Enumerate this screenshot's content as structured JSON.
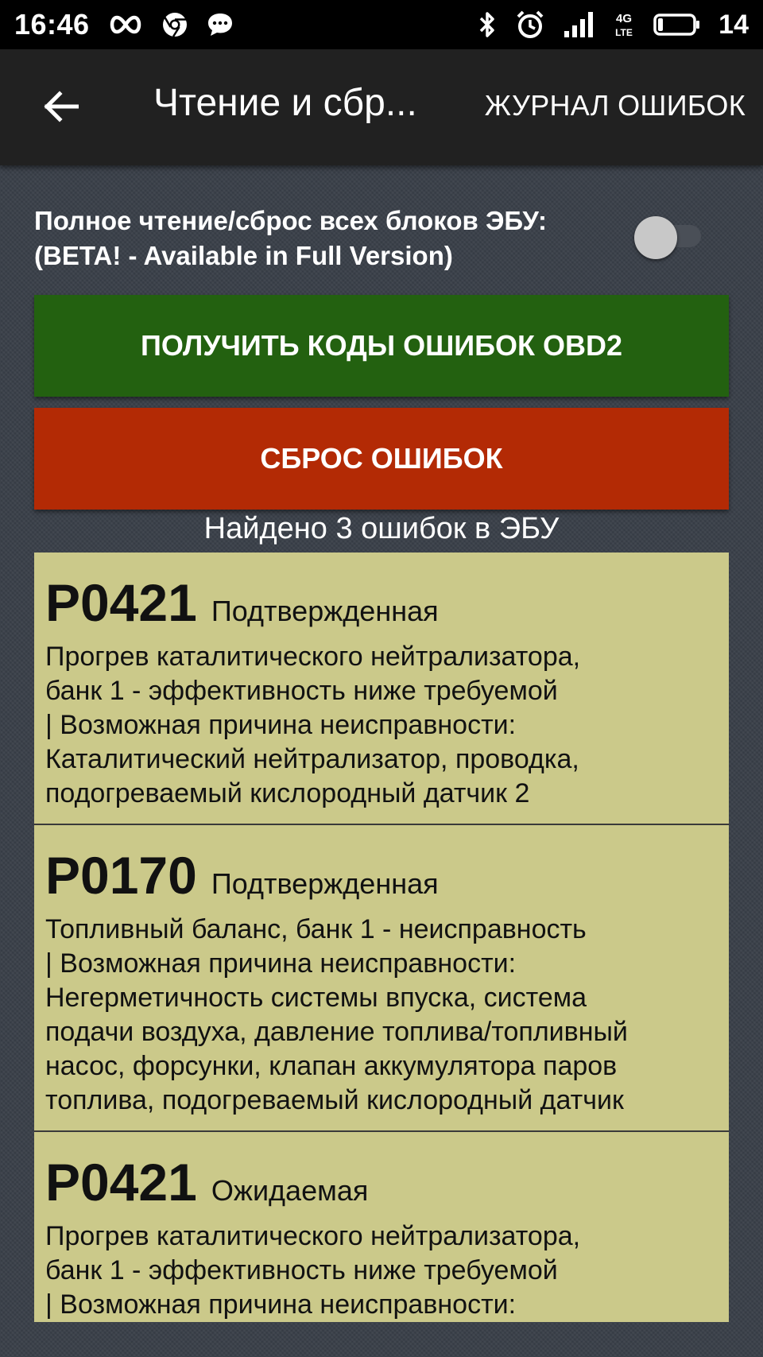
{
  "status_bar": {
    "time": "16:46",
    "battery_level": "14",
    "network_label": "4G LTE",
    "icons": [
      "infinity-icon",
      "chrome-icon",
      "message-icon",
      "bluetooth-icon",
      "alarm-icon",
      "signal-icon",
      "lte-icon",
      "battery-icon"
    ]
  },
  "app_bar": {
    "title": "Чтение и сбр...",
    "journal_label": "ЖУРНАЛ ОШИБОК"
  },
  "full_read": {
    "label_line1": "Полное чтение/сброс всех блоков ЭБУ:",
    "label_line2": "(BETA! - Available in Full Version)",
    "enabled": false
  },
  "buttons": {
    "get_codes": "ПОЛУЧИТЬ КОДЫ ОШИБОК OBD2",
    "reset": "СБРОС ОШИБОК"
  },
  "found_text": "Найдено 3 ошибок в ЭБУ",
  "colors": {
    "get_button": "#236110",
    "reset_button": "#b32a05",
    "error_card": "#cbc98a"
  },
  "errors": [
    {
      "code": "P0421",
      "status": "Подтвержденная",
      "lines": [
        "Прогрев каталитического нейтрализатора,",
        "банк 1 - эффективность ниже требуемой",
        "| Возможная причина неисправности:",
        "Каталитический нейтрализатор, проводка,",
        "подогреваемый кислородный датчик 2"
      ]
    },
    {
      "code": "P0170",
      "status": "Подтвержденная",
      "lines": [
        "Топливный баланс, банк 1 - неисправность",
        "| Возможная причина неисправности:",
        "Негерметичность системы впуска, система",
        "подачи воздуха, давление топлива/топливный",
        "насос, форсунки, клапан аккумулятора паров",
        "топлива, подогреваемый кислородный датчик"
      ]
    },
    {
      "code": "P0421",
      "status": "Ожидаемая",
      "lines": [
        "Прогрев каталитического нейтрализатора,",
        "банк 1 - эффективность ниже требуемой",
        "| Возможная причина неисправности:"
      ]
    }
  ]
}
